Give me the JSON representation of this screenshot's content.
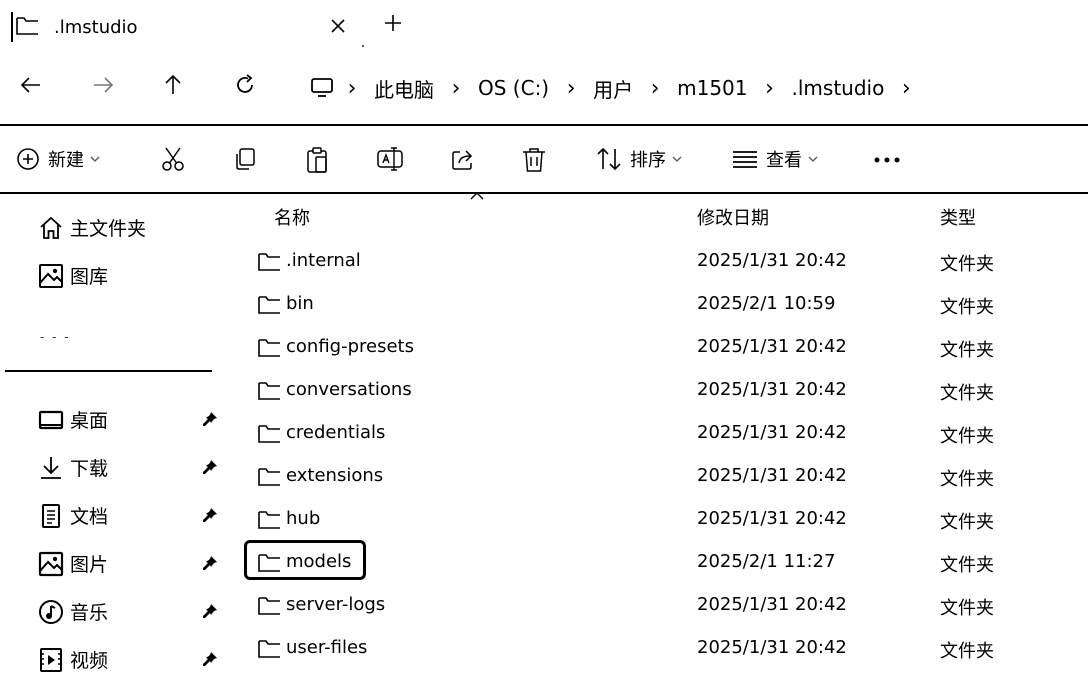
{
  "tab": {
    "title": ".lmstudio",
    "icon": "folder-icon",
    "close_icon": "close-icon",
    "new_tab_icon": "plus-icon"
  },
  "nav": {
    "back_icon": "arrow-left-icon",
    "forward_icon": "arrow-right-icon",
    "up_icon": "arrow-up-icon",
    "refresh_icon": "refresh-icon",
    "root_icon": "monitor-icon",
    "separator": "›",
    "breadcrumbs": [
      "此电脑",
      "OS (C:)",
      "用户",
      "m1501",
      ".lmstudio"
    ]
  },
  "toolbar": {
    "new_label": "新建",
    "sort_label": "排序",
    "view_label": "查看",
    "more_label": "•••",
    "icons": [
      "plus-circle-icon",
      "cut-icon",
      "copy-icon",
      "paste-icon",
      "rename-icon",
      "share-icon",
      "delete-icon",
      "sort-icon",
      "view-icon",
      "more-icon"
    ]
  },
  "sidebar": {
    "top_items": [
      {
        "label": "主文件夹",
        "icon": "home-icon"
      },
      {
        "label": "图库",
        "icon": "gallery-icon"
      }
    ],
    "placeholder": "- - -",
    "pinned_items": [
      {
        "label": "桌面",
        "icon": "desktop-icon"
      },
      {
        "label": "下载",
        "icon": "download-icon"
      },
      {
        "label": "文档",
        "icon": "document-icon"
      },
      {
        "label": "图片",
        "icon": "pictures-icon"
      },
      {
        "label": "音乐",
        "icon": "music-icon"
      },
      {
        "label": "视频",
        "icon": "video-icon"
      }
    ]
  },
  "list": {
    "columns": {
      "name": "名称",
      "modified": "修改日期",
      "type": "类型"
    },
    "rows": [
      {
        "name": ".internal",
        "modified": "2025/1/31 20:42",
        "type": "文件夹"
      },
      {
        "name": "bin",
        "modified": "2025/2/1 10:59",
        "type": "文件夹"
      },
      {
        "name": "config-presets",
        "modified": "2025/1/31 20:42",
        "type": "文件夹"
      },
      {
        "name": "conversations",
        "modified": "2025/1/31 20:42",
        "type": "文件夹"
      },
      {
        "name": "credentials",
        "modified": "2025/1/31 20:42",
        "type": "文件夹"
      },
      {
        "name": "extensions",
        "modified": "2025/1/31 20:42",
        "type": "文件夹"
      },
      {
        "name": "hub",
        "modified": "2025/1/31 20:42",
        "type": "文件夹"
      },
      {
        "name": "models",
        "modified": "2025/2/1 11:27",
        "type": "文件夹",
        "highlighted": true
      },
      {
        "name": "server-logs",
        "modified": "2025/1/31 20:42",
        "type": "文件夹"
      },
      {
        "name": "user-files",
        "modified": "2025/1/31 20:42",
        "type": "文件夹"
      }
    ]
  }
}
